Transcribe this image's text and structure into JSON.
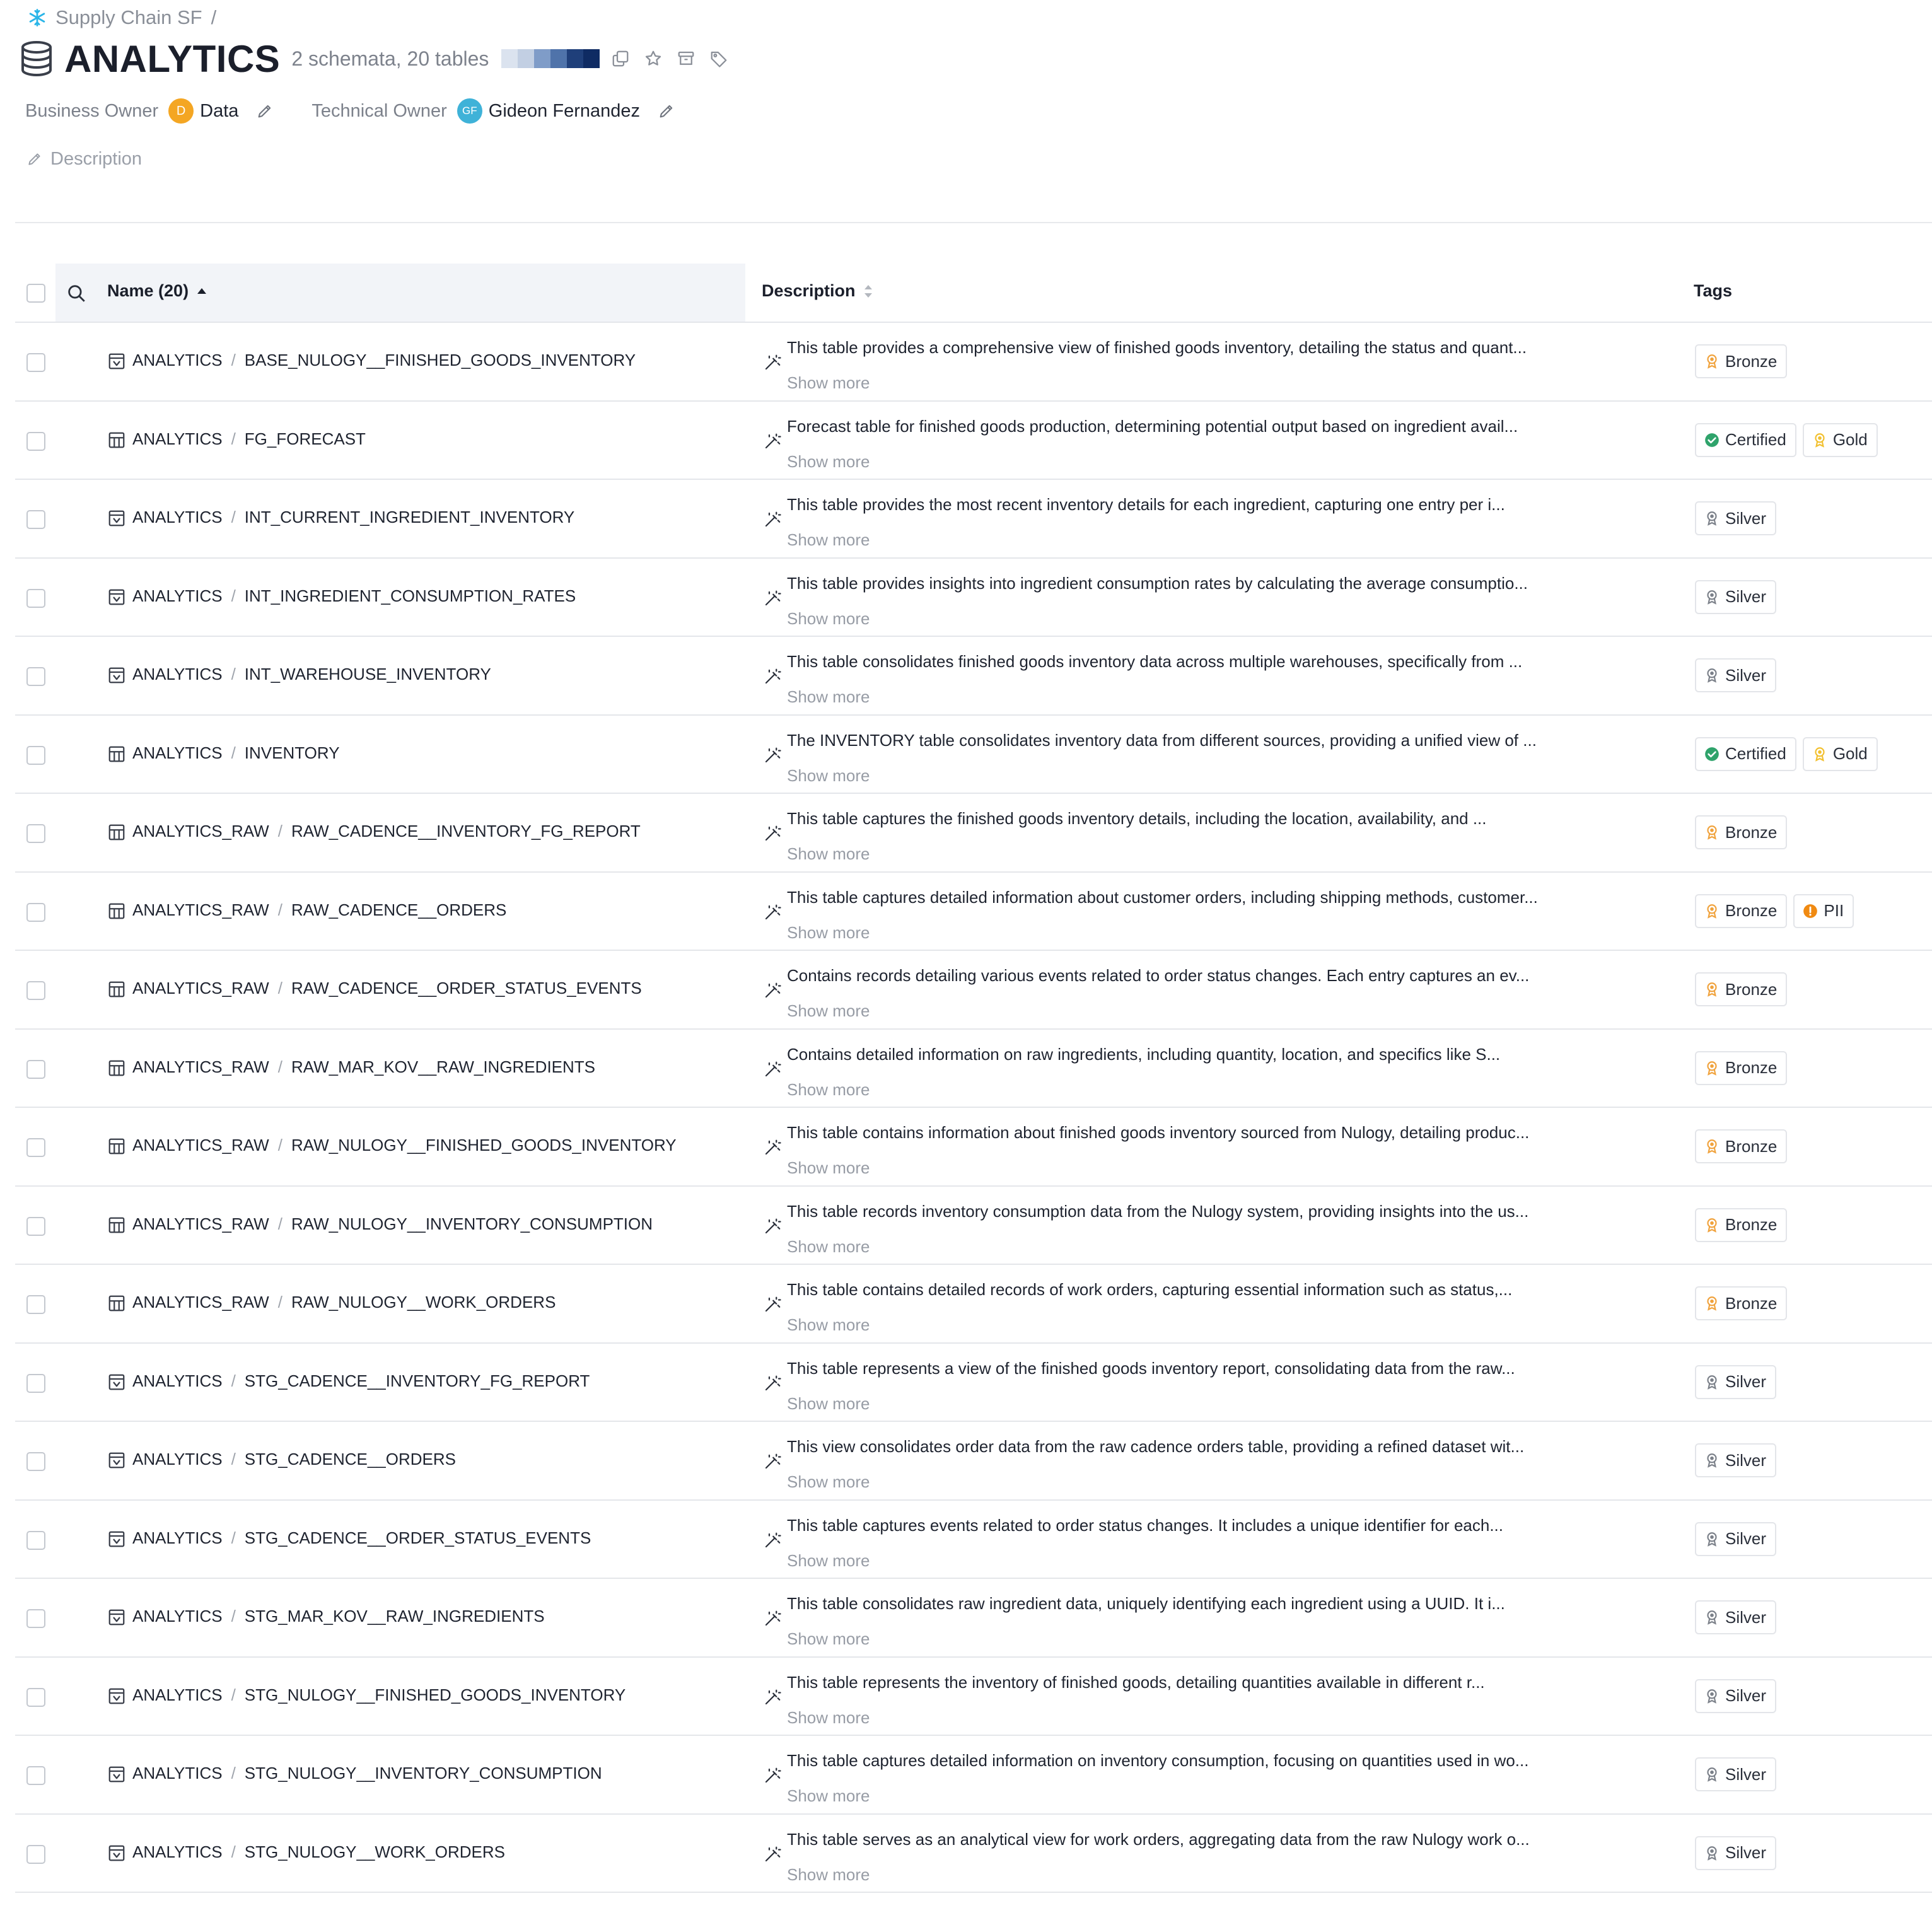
{
  "breadcrumb": {
    "source": "Supply Chain SF",
    "separator": "/"
  },
  "header": {
    "title": "ANALYTICS",
    "subtitle": "2 schemata, 20 tables",
    "heat_colors": [
      "#dbe3ef",
      "#c2cfe3",
      "#7f9cc8",
      "#4f73aa",
      "#1f3f7a",
      "#0f2b63"
    ]
  },
  "owners": {
    "business_label": "Business Owner",
    "business_initial": "D",
    "business_name": "Data",
    "technical_label": "Technical Owner",
    "technical_initials": "GF",
    "technical_name": "Gideon Fernandez"
  },
  "description_link": "Description",
  "table": {
    "col_name": "Name (20)",
    "col_desc": "Description",
    "col_tags": "Tags",
    "show_more": "Show more",
    "rows": [
      {
        "schema": "ANALYTICS",
        "name": "BASE_NULOGY__FINISHED_GOODS_INVENTORY",
        "kind": "view",
        "desc": "This table provides a comprehensive view of finished goods inventory, detailing the status and quant...",
        "tags": [
          {
            "label": "Bronze",
            "type": "bronze"
          }
        ]
      },
      {
        "schema": "ANALYTICS",
        "name": "FG_FORECAST",
        "kind": "table",
        "desc": "Forecast table for finished goods production, determining potential output based on ingredient avail...",
        "tags": [
          {
            "label": "Certified",
            "type": "certified"
          },
          {
            "label": "Gold",
            "type": "gold"
          }
        ]
      },
      {
        "schema": "ANALYTICS",
        "name": "INT_CURRENT_INGREDIENT_INVENTORY",
        "kind": "view",
        "desc": "This table provides the most recent inventory details for each ingredient, capturing one entry per i...",
        "tags": [
          {
            "label": "Silver",
            "type": "silver"
          }
        ]
      },
      {
        "schema": "ANALYTICS",
        "name": "INT_INGREDIENT_CONSUMPTION_RATES",
        "kind": "view",
        "desc": "This table provides insights into ingredient consumption rates by calculating the average consumptio...",
        "tags": [
          {
            "label": "Silver",
            "type": "silver"
          }
        ]
      },
      {
        "schema": "ANALYTICS",
        "name": "INT_WAREHOUSE_INVENTORY",
        "kind": "view",
        "desc": "This table consolidates finished goods inventory data across multiple warehouses, specifically from ...",
        "tags": [
          {
            "label": "Silver",
            "type": "silver"
          }
        ]
      },
      {
        "schema": "ANALYTICS",
        "name": "INVENTORY",
        "kind": "table",
        "desc": "The INVENTORY table consolidates inventory data from different sources, providing a unified view of ...",
        "tags": [
          {
            "label": "Certified",
            "type": "certified"
          },
          {
            "label": "Gold",
            "type": "gold"
          }
        ]
      },
      {
        "schema": "ANALYTICS_RAW",
        "name": "RAW_CADENCE__INVENTORY_FG_REPORT",
        "kind": "table",
        "desc": "This table captures the finished goods inventory details, including the location, availability, and ...",
        "tags": [
          {
            "label": "Bronze",
            "type": "bronze"
          }
        ]
      },
      {
        "schema": "ANALYTICS_RAW",
        "name": "RAW_CADENCE__ORDERS",
        "kind": "table",
        "desc": "This table captures detailed information about customer orders, including shipping methods, customer...",
        "tags": [
          {
            "label": "Bronze",
            "type": "bronze"
          },
          {
            "label": "PII",
            "type": "pii"
          }
        ]
      },
      {
        "schema": "ANALYTICS_RAW",
        "name": "RAW_CADENCE__ORDER_STATUS_EVENTS",
        "kind": "table",
        "desc": "Contains records detailing various events related to order status changes. Each entry captures an ev...",
        "tags": [
          {
            "label": "Bronze",
            "type": "bronze"
          }
        ]
      },
      {
        "schema": "ANALYTICS_RAW",
        "name": "RAW_MAR_KOV__RAW_INGREDIENTS",
        "kind": "table",
        "desc": "Contains detailed information on raw ingredients, including quantity, location, and specifics like S...",
        "tags": [
          {
            "label": "Bronze",
            "type": "bronze"
          }
        ]
      },
      {
        "schema": "ANALYTICS_RAW",
        "name": "RAW_NULOGY__FINISHED_GOODS_INVENTORY",
        "kind": "table",
        "desc": "This table contains information about finished goods inventory sourced from Nulogy, detailing produc...",
        "tags": [
          {
            "label": "Bronze",
            "type": "bronze"
          }
        ]
      },
      {
        "schema": "ANALYTICS_RAW",
        "name": "RAW_NULOGY__INVENTORY_CONSUMPTION",
        "kind": "table",
        "desc": "This table records inventory consumption data from the Nulogy system, providing insights into the us...",
        "tags": [
          {
            "label": "Bronze",
            "type": "bronze"
          }
        ]
      },
      {
        "schema": "ANALYTICS_RAW",
        "name": "RAW_NULOGY__WORK_ORDERS",
        "kind": "table",
        "desc": "This table contains detailed records of work orders, capturing essential information such as status,...",
        "tags": [
          {
            "label": "Bronze",
            "type": "bronze"
          }
        ]
      },
      {
        "schema": "ANALYTICS",
        "name": "STG_CADENCE__INVENTORY_FG_REPORT",
        "kind": "view",
        "desc": "This table represents a view of the finished goods inventory report, consolidating data from the raw...",
        "tags": [
          {
            "label": "Silver",
            "type": "silver"
          }
        ]
      },
      {
        "schema": "ANALYTICS",
        "name": "STG_CADENCE__ORDERS",
        "kind": "view",
        "desc": "This view consolidates order data from the raw cadence orders table, providing a refined dataset wit...",
        "tags": [
          {
            "label": "Silver",
            "type": "silver"
          }
        ]
      },
      {
        "schema": "ANALYTICS",
        "name": "STG_CADENCE__ORDER_STATUS_EVENTS",
        "kind": "view",
        "desc": "This table captures events related to order status changes. It includes a unique identifier for each...",
        "tags": [
          {
            "label": "Silver",
            "type": "silver"
          }
        ]
      },
      {
        "schema": "ANALYTICS",
        "name": "STG_MAR_KOV__RAW_INGREDIENTS",
        "kind": "view",
        "desc": "This table consolidates raw ingredient data, uniquely identifying each ingredient using a UUID. It i...",
        "tags": [
          {
            "label": "Silver",
            "type": "silver"
          }
        ]
      },
      {
        "schema": "ANALYTICS",
        "name": "STG_NULOGY__FINISHED_GOODS_INVENTORY",
        "kind": "view",
        "desc": "This table represents the inventory of finished goods, detailing quantities available in different r...",
        "tags": [
          {
            "label": "Silver",
            "type": "silver"
          }
        ]
      },
      {
        "schema": "ANALYTICS",
        "name": "STG_NULOGY__INVENTORY_CONSUMPTION",
        "kind": "view",
        "desc": "This table captures detailed information on inventory consumption, focusing on quantities used in wo...",
        "tags": [
          {
            "label": "Silver",
            "type": "silver"
          }
        ]
      },
      {
        "schema": "ANALYTICS",
        "name": "STG_NULOGY__WORK_ORDERS",
        "kind": "view",
        "desc": "This table serves as an analytical view for work orders, aggregating data from the raw Nulogy work o...",
        "tags": [
          {
            "label": "Silver",
            "type": "silver"
          }
        ]
      }
    ]
  },
  "colors": {
    "bronze": "#f0a23c",
    "gold": "#f2c02e",
    "silver": "#7b8089",
    "certified": "#2fa36b",
    "pii": "#f08a12",
    "avatar_business": "#f4a623",
    "avatar_technical": "#3fb2d8",
    "snowflake": "#29b5e8"
  }
}
